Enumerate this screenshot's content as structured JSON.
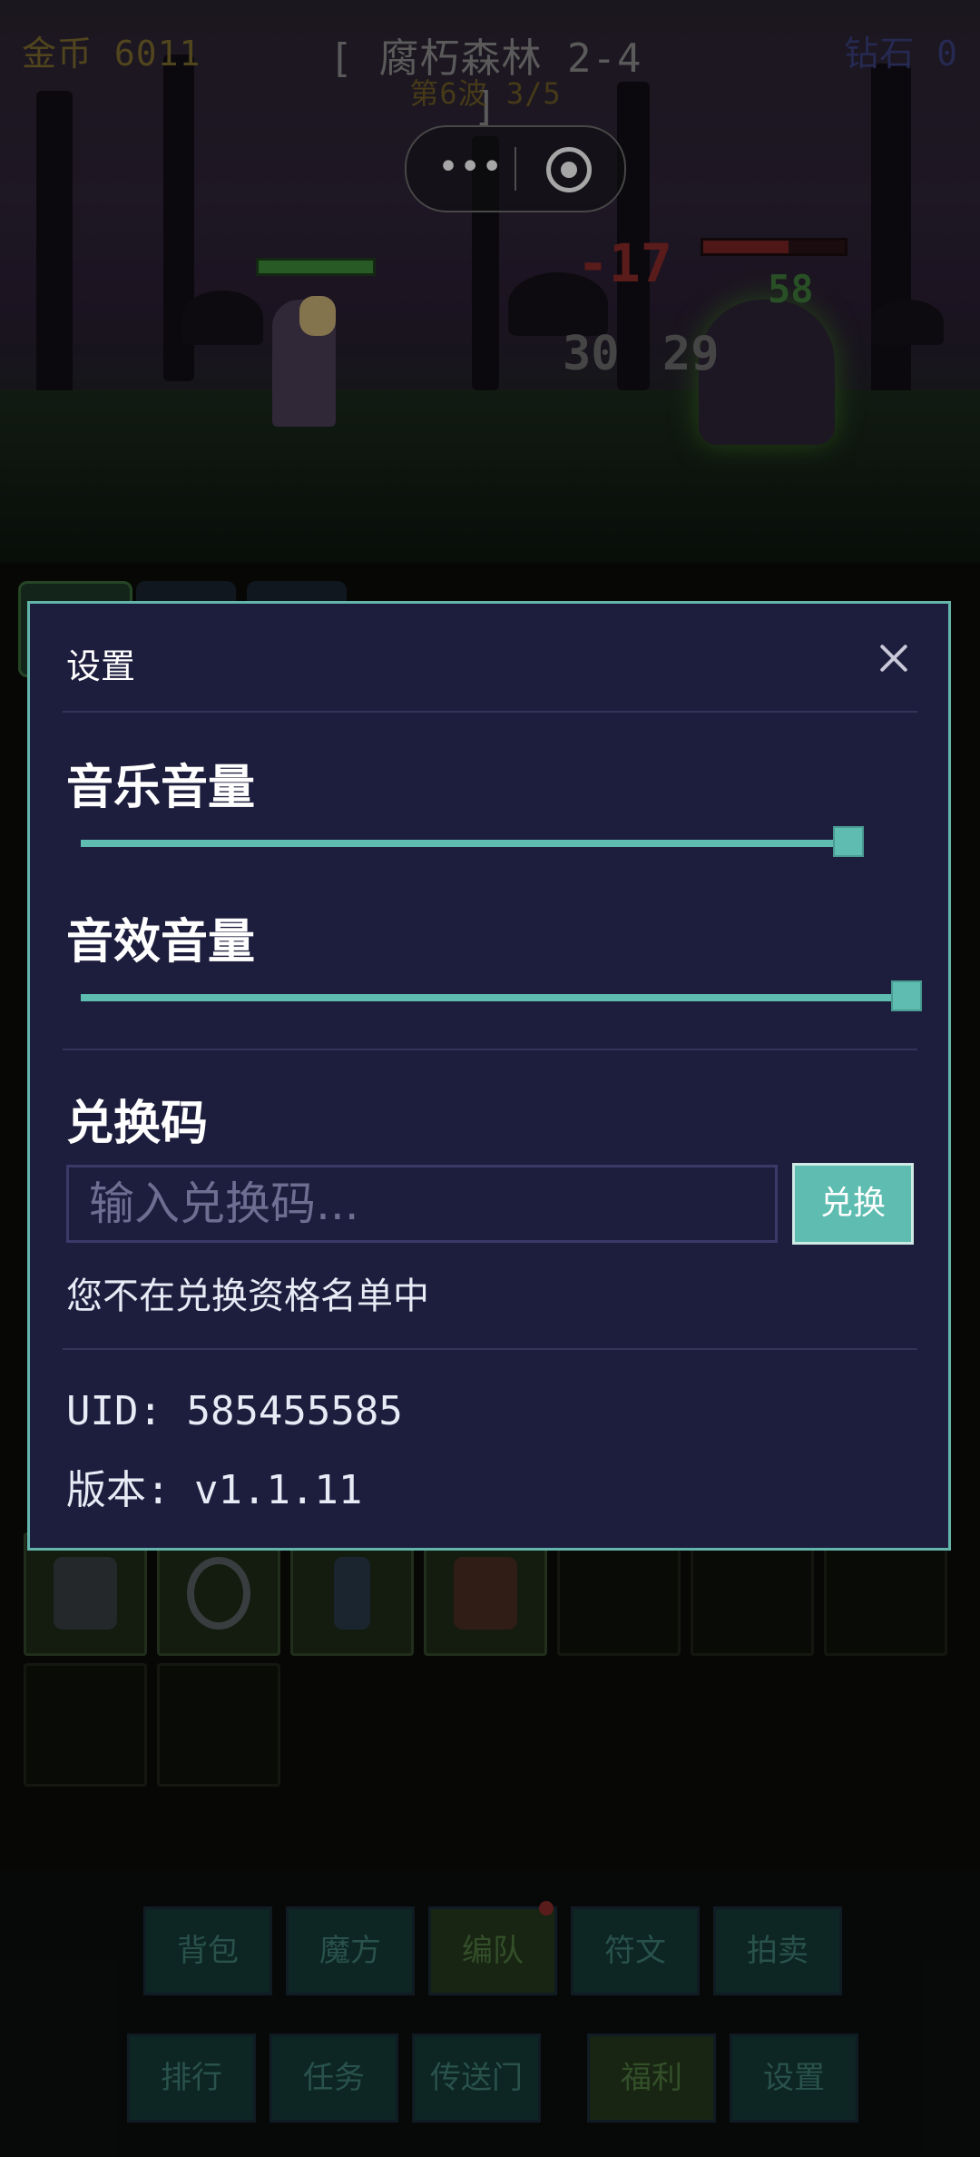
{
  "hud": {
    "gold": "金币 6011",
    "stage": "[ 腐朽森林 2-4 ]",
    "wave": "第6波 3/5",
    "gems": "钻石 0"
  },
  "battle": {
    "damage_red": "-17",
    "damage_green": "58",
    "damage_grey_1": "30",
    "damage_grey_2": "29",
    "enemy_hp_fraction": 0.6
  },
  "bottom_nav": {
    "row1": [
      "背包",
      "魔方",
      "编队",
      "符文",
      "拍卖"
    ],
    "row2": [
      "排行",
      "任务",
      "传送门",
      "福利",
      "设置"
    ]
  },
  "settings": {
    "title": "设置",
    "music_label": "音乐音量",
    "music_volume": 0.93,
    "sfx_label": "音效音量",
    "sfx_volume": 1.0,
    "redeem_label": "兑换码",
    "redeem_placeholder": "输入兑换码...",
    "redeem_button": "兑换",
    "redeem_status": "您不在兑换资格名单中",
    "uid": "UID: 585455585",
    "version": "版本: v1.1.11"
  },
  "colors": {
    "accent": "#5ebcb0",
    "modal_bg": "#1d1d3d"
  }
}
